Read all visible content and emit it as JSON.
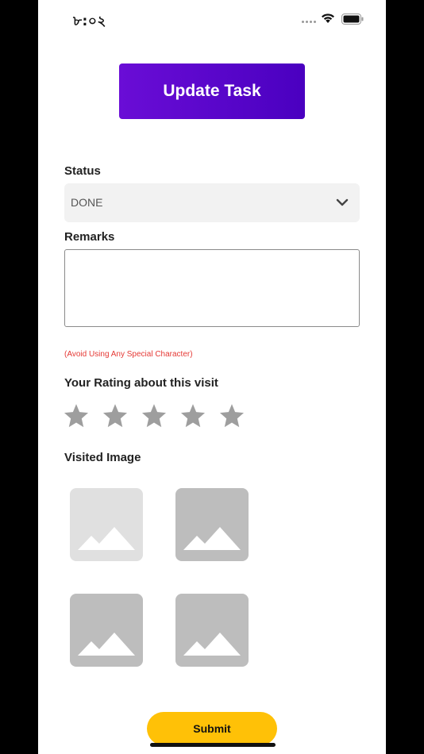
{
  "status_bar": {
    "time": "৮:০২"
  },
  "header": {
    "title": "Update Task"
  },
  "form": {
    "status_label": "Status",
    "status_value": "DONE",
    "remarks_label": "Remarks",
    "remarks_value": "",
    "hint": "(Avoid Using Any Special Character)",
    "rating_label": "Your Rating about this visit",
    "rating": {
      "value": 0,
      "max": 5
    },
    "visited_image_label": "Visited Image",
    "images": [
      {
        "icon": "image-placeholder-icon",
        "state": "light"
      },
      {
        "icon": "image-placeholder-icon",
        "state": "dark"
      },
      {
        "icon": "image-placeholder-icon",
        "state": "dark"
      },
      {
        "icon": "image-placeholder-icon",
        "state": "dark"
      }
    ]
  },
  "submit": {
    "label": "Submit"
  },
  "colors": {
    "header_button": "#5200c8",
    "submit_button": "#ffc107",
    "hint_text": "#e53935",
    "star": "#9e9e9e"
  }
}
